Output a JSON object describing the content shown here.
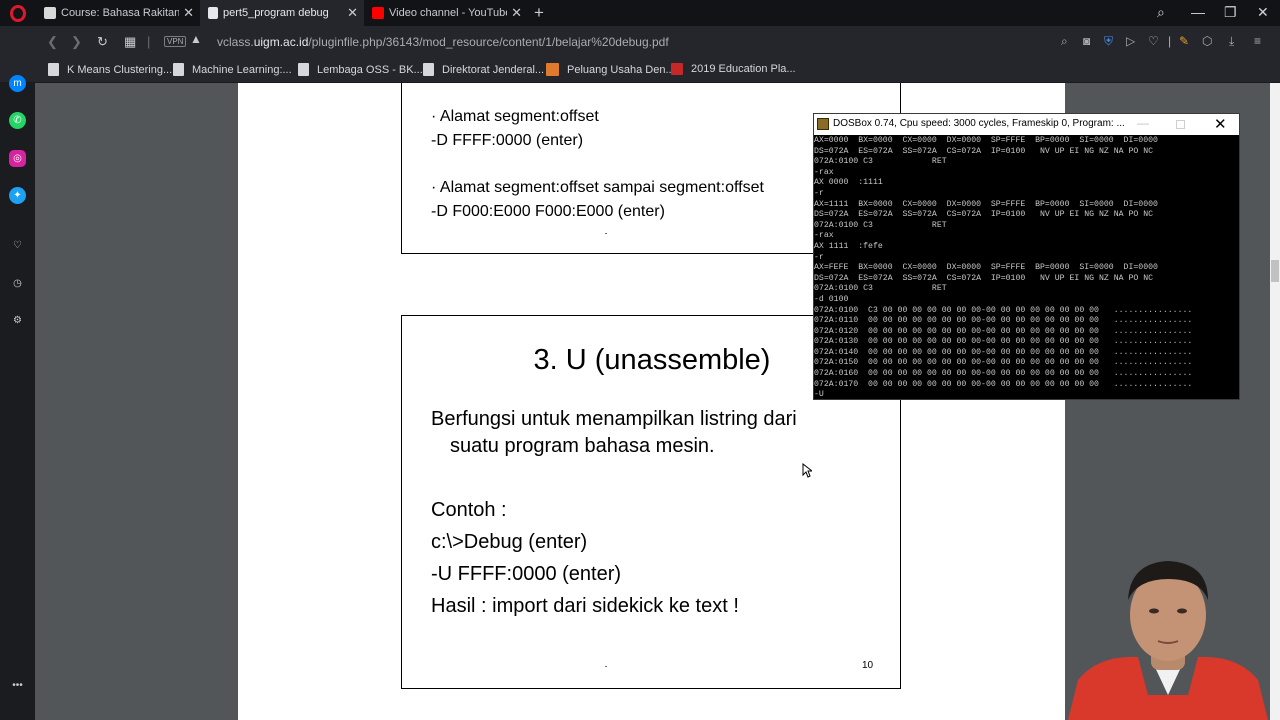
{
  "tabs": [
    {
      "label": "Course: Bahasa Rakitan (Ka",
      "icon": "moodle-icon",
      "active": false
    },
    {
      "label": "pert5_program debug",
      "icon": "document-icon",
      "active": true
    },
    {
      "label": "Video channel - YouTube S",
      "icon": "youtube-icon",
      "active": false
    }
  ],
  "address": {
    "vpn": "VPN",
    "url_prefix": "vclass.",
    "url_domain": "uigm.ac.id",
    "url_path": "/pluginfile.php/36143/mod_resource/content/1/belajar%20debug.pdf"
  },
  "bookmarks": [
    {
      "label": "K Means Clustering..."
    },
    {
      "label": "Machine Learning:..."
    },
    {
      "label": "Lembaga OSS - BK..."
    },
    {
      "label": "Direktorat Jenderal..."
    },
    {
      "label": "Peluang Usaha Den..."
    },
    {
      "label": "2019 Education Pla..."
    }
  ],
  "slide1": {
    "line1": "· Alamat segment:offset",
    "line2": "-D FFFF:0000 (enter)",
    "line3": "· Alamat segment:offset sampai segment:offset",
    "line4": "-D F000:E000 F000:E000 (enter)"
  },
  "slide2": {
    "title": "3. U (unassemble)",
    "desc1": "Berfungsi untuk menampilkan listring dari",
    "desc2": "suatu program bahasa mesin.",
    "example_label": "Contoh :",
    "cmd1": "c:\\>Debug (enter)",
    "cmd2": "-U FFFF:0000 (enter)",
    "result": "Hasil : import dari sidekick ke text !",
    "page_number": "10"
  },
  "dosbox": {
    "title": "DOSBox 0.74, Cpu speed:    3000 cycles, Frameskip  0, Program: ...",
    "lines": [
      "AX=0000  BX=0000  CX=0000  DX=0000  SP=FFFE  BP=0000  SI=0000  DI=0000",
      "DS=072A  ES=072A  SS=072A  CS=072A  IP=0100   NV UP EI NG NZ NA PO NC",
      "072A:0100 C3            RET",
      "-rax",
      "AX 0000  :1111",
      "-r",
      "AX=1111  BX=0000  CX=0000  DX=0000  SP=FFFE  BP=0000  SI=0000  DI=0000",
      "DS=072A  ES=072A  SS=072A  CS=072A  IP=0100   NV UP EI NG NZ NA PO NC",
      "072A:0100 C3            RET",
      "-rax",
      "AX 1111  :fefe",
      "-r",
      "AX=FEFE  BX=0000  CX=0000  DX=0000  SP=FFFE  BP=0000  SI=0000  DI=0000",
      "DS=072A  ES=072A  SS=072A  CS=072A  IP=0100   NV UP EI NG NZ NA PO NC",
      "072A:0100 C3            RET",
      "-d 0100",
      "072A:0100  C3 00 00 00 00 00 00 00-00 00 00 00 00 00 00 00   ................",
      "072A:0110  00 00 00 00 00 00 00 00-00 00 00 00 00 00 00 00   ................",
      "072A:0120  00 00 00 00 00 00 00 00-00 00 00 00 00 00 00 00   ................",
      "072A:0130  00 00 00 00 00 00 00 00-00 00 00 00 00 00 00 00   ................",
      "072A:0140  00 00 00 00 00 00 00 00-00 00 00 00 00 00 00 00   ................",
      "072A:0150  00 00 00 00 00 00 00 00-00 00 00 00 00 00 00 00   ................",
      "072A:0160  00 00 00 00 00 00 00 00-00 00 00 00 00 00 00 00   ................",
      "072A:0170  00 00 00 00 00 00 00 00-00 00 00 00 00 00 00 00   ................",
      "-U"
    ]
  }
}
